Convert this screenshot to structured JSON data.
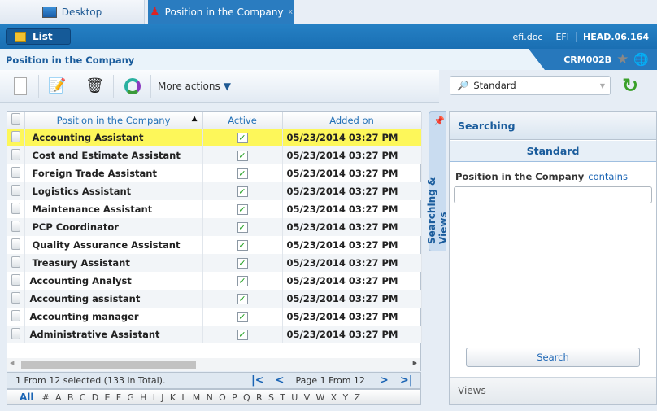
{
  "tabs": [
    {
      "label": "Desktop",
      "icon": "monitor-icon"
    },
    {
      "label": "Position in the Company",
      "icon": "person-icon",
      "close": "x"
    }
  ],
  "topbar": {
    "list_label": "List",
    "items": [
      "efi.doc",
      "EFI",
      "HEAD.06.164"
    ]
  },
  "title": {
    "text": "Position in the Company",
    "code": "CRM002B"
  },
  "toolbar": {
    "more_actions": "More actions"
  },
  "search_select": {
    "value": "Standard"
  },
  "grid": {
    "columns": [
      "Position in the Company",
      "Active",
      "Added on"
    ],
    "rows": [
      {
        "name": "Accounting Assistant",
        "active": true,
        "added": "05/23/2014 03:27 PM",
        "selected": true
      },
      {
        "name": "Cost and Estimate Assistant",
        "active": true,
        "added": "05/23/2014 03:27 PM"
      },
      {
        "name": "Foreign Trade Assistant",
        "active": true,
        "added": "05/23/2014 03:27 PM"
      },
      {
        "name": "Logistics Assistant",
        "active": true,
        "added": "05/23/2014 03:27 PM"
      },
      {
        "name": "Maintenance Assistant",
        "active": true,
        "added": "05/23/2014 03:27 PM"
      },
      {
        "name": "PCP Coordinator",
        "active": true,
        "added": "05/23/2014 03:27 PM"
      },
      {
        "name": "Quality Assurance Assistant",
        "active": true,
        "added": "05/23/2014 03:27 PM"
      },
      {
        "name": "Treasury Assistant",
        "active": true,
        "added": "05/23/2014 03:27 PM"
      },
      {
        "name": "Accounting Analyst",
        "active": true,
        "added": "05/23/2014 03:27 PM"
      },
      {
        "name": "Accounting assistant",
        "active": true,
        "added": "05/23/2014 03:27 PM"
      },
      {
        "name": "Accounting manager",
        "active": true,
        "added": "05/23/2014 03:27 PM"
      },
      {
        "name": "Administrative Assistant",
        "active": true,
        "added": "05/23/2014 03:27 PM"
      }
    ]
  },
  "pager": {
    "status": "1 From 12 selected (133 in Total).",
    "page": "Page 1 From 12"
  },
  "alpha": [
    "All",
    "#",
    "A",
    "B",
    "C",
    "D",
    "E",
    "F",
    "G",
    "H",
    "I",
    "J",
    "K",
    "L",
    "M",
    "N",
    "O",
    "P",
    "Q",
    "R",
    "S",
    "T",
    "U",
    "V",
    "W",
    "X",
    "Y",
    "Z"
  ],
  "panel": {
    "side_tab": "Searching & Views",
    "searching": "Searching",
    "standard": "Standard",
    "field_label": "Position in the Company",
    "operator": "contains",
    "field_value": "",
    "search_button": "Search",
    "views": "Views"
  }
}
